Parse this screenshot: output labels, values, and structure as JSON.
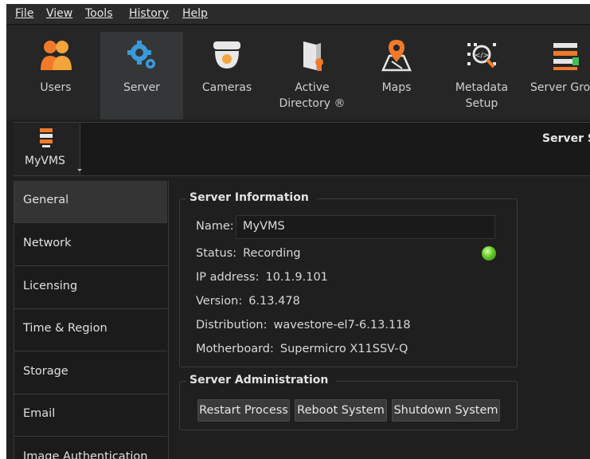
{
  "menu": [
    "File",
    "View",
    "Tools",
    "History",
    "Help"
  ],
  "toolbar": [
    {
      "label": "Users",
      "icon": "users-icon"
    },
    {
      "label": "Server",
      "icon": "server-gear-icon"
    },
    {
      "label": "Cameras",
      "icon": "camera-dome-icon"
    },
    {
      "label": "Active\nDirectory ®",
      "icon": "active-directory-icon"
    },
    {
      "label": "Maps",
      "icon": "map-pin-icon"
    },
    {
      "label": "Metadata\nSetup",
      "icon": "metadata-icon"
    },
    {
      "label": "Server Gro",
      "icon": "server-groups-icon"
    }
  ],
  "subbar": {
    "server": "MyVMS",
    "title": "Server Se"
  },
  "sidebar": [
    "General",
    "Network",
    "Licensing",
    "Time & Region",
    "Storage",
    "Email",
    "Image Authentication"
  ],
  "server_info": {
    "title": "Server Information",
    "name_label": "Name:",
    "name_value": "MyVMS",
    "status_label": "Status:",
    "status_value": "Recording",
    "ip_label": "IP address:",
    "ip_value": "10.1.9.101",
    "version_label": "Version:",
    "version_value": "6.13.478",
    "distribution_label": "Distribution:",
    "distribution_value": "wavestore-el7-6.13.118",
    "motherboard_label": "Motherboard:",
    "motherboard_value": "Supermicro X11SSV-Q"
  },
  "server_admin": {
    "title": "Server Administration",
    "restart": "Restart Process",
    "reboot": "Reboot System",
    "shutdown": "Shutdown System"
  },
  "colors": {
    "status_led": "#6cd12c",
    "accent_orange": "#f07a2a",
    "accent_blue": "#3b9ad9"
  }
}
